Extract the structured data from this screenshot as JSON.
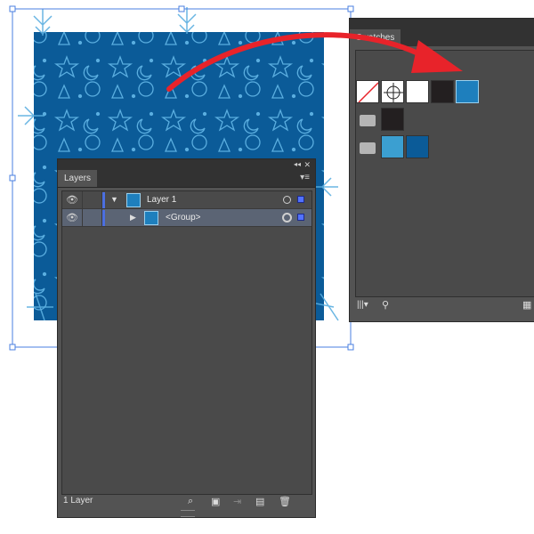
{
  "canvas": {
    "pattern_color": "#0b5b98",
    "pattern_motif_color": "#5aaee0"
  },
  "layers_panel": {
    "tab": "Layers",
    "rows": [
      {
        "label": "Layer 1",
        "expanded": true
      },
      {
        "label": "<Group>",
        "expanded": false
      }
    ],
    "footer_text": "1 Layer",
    "icons": [
      "search-icon",
      "make-clipping-mask-icon",
      "move-to-layer-icon",
      "new-layer-icon",
      "delete-icon"
    ]
  },
  "swatches_panel": {
    "tab": "Swatches",
    "question_mark": "?",
    "swatch_rows": [
      [
        "#ffffff-none",
        "registration",
        "#ffffff",
        "#231f20",
        "pattern"
      ],
      [
        "folder",
        "#231f20"
      ],
      [
        "folder",
        "#3b9fd1",
        "#0b5b98"
      ]
    ]
  },
  "colors": {
    "accent": "#4b6fe0",
    "arrow": "#e8232a"
  }
}
